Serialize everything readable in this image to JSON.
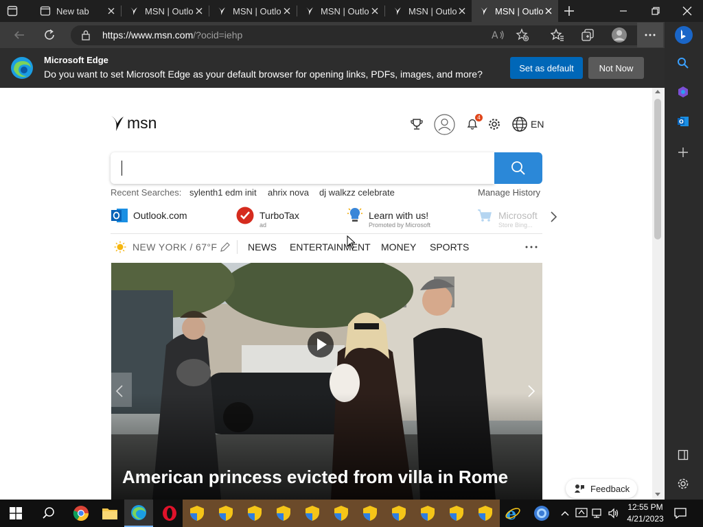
{
  "tabs": [
    {
      "label": "New tab"
    },
    {
      "label": "MSN | Outlo"
    },
    {
      "label": "MSN | Outlo"
    },
    {
      "label": "MSN | Outlo"
    },
    {
      "label": "MSN | Outlo"
    },
    {
      "label": "MSN | Outlo"
    }
  ],
  "address": {
    "url_host": "https://www.msn.com",
    "url_path": "/?ocid=iehp"
  },
  "infobar": {
    "title": "Microsoft Edge",
    "message": "Do you want to set Microsoft Edge as your default browser for opening links, PDFs, images, and more?",
    "primary": "Set as default",
    "secondary": "Not Now"
  },
  "msn": {
    "logo": "msn",
    "notif_count": "4",
    "lang": "EN",
    "recent_label": "Recent Searches:",
    "recent": [
      "sylenth1 edm init",
      "ahrix nova",
      "dj walkzz celebrate"
    ],
    "manage_history": "Manage History",
    "quicklinks": [
      {
        "label": "Outlook.com",
        "sub": ""
      },
      {
        "label": "TurboTax",
        "sub": "ad"
      },
      {
        "label": "Learn with us!",
        "sub": "Promoted by Microsoft"
      },
      {
        "label": "Microsoft",
        "sub": "Store Bing..."
      }
    ],
    "weather": "NEW YORK / 67°F",
    "nav": [
      "NEWS",
      "ENTERTAINMENT",
      "MONEY",
      "SPORTS"
    ],
    "hero_title": "American princess evicted from villa in Rome",
    "feedback": "Feedback"
  },
  "taskbar": {
    "time": "12:55 PM",
    "date": "4/21/2023"
  },
  "colors": {
    "accent": "#0067b8",
    "search": "#2b88d8",
    "dark": "#1f1f1f"
  }
}
